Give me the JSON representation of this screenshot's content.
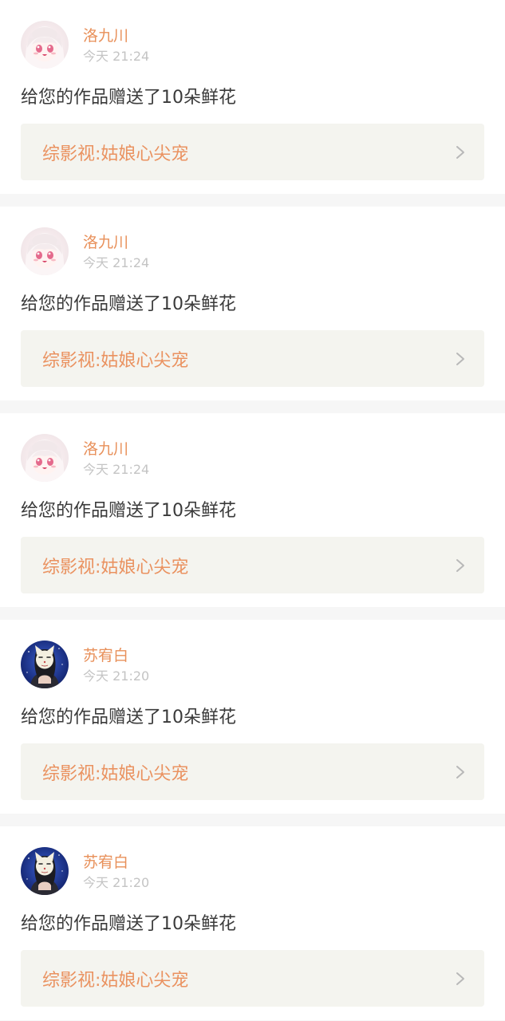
{
  "colors": {
    "accent_name": "#e8905a",
    "accent_title": "#ea9260",
    "time_gray": "#c4c4c4",
    "message_text": "#3a3a3a",
    "link_background": "#f4f4ef",
    "divider_background": "#f6f6f6"
  },
  "notifications": [
    {
      "avatar": "anime-girl-white-hair-avatar",
      "name": "洛九川",
      "time": "今天 21:24",
      "message": "给您的作品赠送了10朵鲜花",
      "work_title": "综影视:姑娘心尖宠",
      "link_icon": "chevron-right-icon"
    },
    {
      "avatar": "anime-girl-white-hair-avatar",
      "name": "洛九川",
      "time": "今天 21:24",
      "message": "给您的作品赠送了10朵鲜花",
      "work_title": "综影视:姑娘心尖宠",
      "link_icon": "chevron-right-icon"
    },
    {
      "avatar": "anime-girl-white-hair-avatar",
      "name": "洛九川",
      "time": "今天 21:24",
      "message": "给您的作品赠送了10朵鲜花",
      "work_title": "综影视:姑娘心尖宠",
      "link_icon": "chevron-right-icon"
    },
    {
      "avatar": "cat-mask-night-avatar",
      "name": "苏宥白",
      "time": "今天 21:20",
      "message": "给您的作品赠送了10朵鲜花",
      "work_title": "综影视:姑娘心尖宠",
      "link_icon": "chevron-right-icon"
    },
    {
      "avatar": "cat-mask-night-avatar",
      "name": "苏宥白",
      "time": "今天 21:20",
      "message": "给您的作品赠送了10朵鲜花",
      "work_title": "综影视:姑娘心尖宠",
      "link_icon": "chevron-right-icon"
    }
  ]
}
